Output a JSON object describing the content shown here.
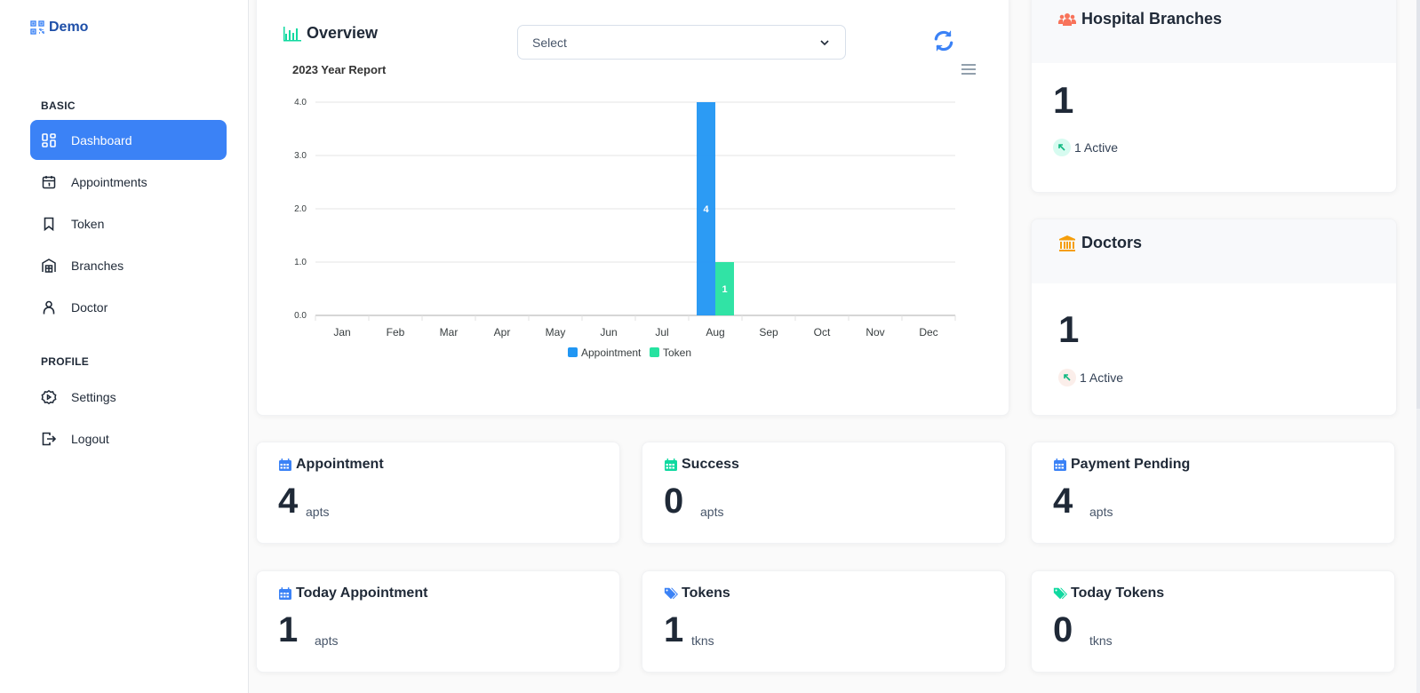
{
  "brand": {
    "name": "Demo",
    "icon": "qr-code-icon",
    "color": "#1e4fa8"
  },
  "sidebar": {
    "sections": [
      {
        "label": "BASIC",
        "items": [
          {
            "label": "Dashboard",
            "icon": "dashboard-icon",
            "active": true
          },
          {
            "label": "Appointments",
            "icon": "calendar-icon",
            "active": false
          },
          {
            "label": "Token",
            "icon": "bookmark-icon",
            "active": false
          },
          {
            "label": "Branches",
            "icon": "building-icon",
            "active": false
          },
          {
            "label": "Doctor",
            "icon": "user-icon",
            "active": false
          }
        ]
      },
      {
        "label": "PROFILE",
        "items": [
          {
            "label": "Settings",
            "icon": "gear-icon",
            "active": false
          },
          {
            "label": "Logout",
            "icon": "logout-icon",
            "active": false
          }
        ]
      }
    ],
    "active_color": "#3b82f6"
  },
  "overview": {
    "title": "Overview",
    "select": {
      "value": "Select"
    },
    "refresh_icon": "refresh-icon",
    "menu_icon": "hamburger-menu-icon"
  },
  "chart_data": {
    "type": "bar",
    "title": "2023 Year Report",
    "categories": [
      "Jan",
      "Feb",
      "Mar",
      "Apr",
      "May",
      "Jun",
      "Jul",
      "Aug",
      "Sep",
      "Oct",
      "Nov",
      "Dec"
    ],
    "series": [
      {
        "name": "Appointment",
        "color": "#2196f3",
        "values": [
          0,
          0,
          0,
          0,
          0,
          0,
          0,
          4,
          0,
          0,
          0,
          0
        ]
      },
      {
        "name": "Token",
        "color": "#26e2a0",
        "values": [
          0,
          0,
          0,
          0,
          0,
          0,
          0,
          1,
          0,
          0,
          0,
          0
        ]
      }
    ],
    "ylim": [
      0,
      4
    ],
    "yticks": [
      "0.0",
      "1.0",
      "2.0",
      "3.0",
      "4.0"
    ],
    "grid": true,
    "legend": "bottom-center",
    "data_labels": true,
    "xlabel": "",
    "ylabel": ""
  },
  "branches": {
    "title": "Hospital Branches",
    "icon": "users-icon",
    "icon_color": "#f8735a",
    "count": "1",
    "active_text": "1 Active"
  },
  "doctors": {
    "title": "Doctors",
    "icon": "bank-icon",
    "icon_color": "#f59e0b",
    "count": "1",
    "active_text": "1 Active"
  },
  "stats": [
    {
      "title": "Appointment",
      "icon": "calendar-icon",
      "icon_color": "#3b82f6",
      "value": "4",
      "unit": "apts"
    },
    {
      "title": "Success",
      "icon": "calendar-icon",
      "icon_color": "#10d9a0",
      "value": "0",
      "unit": "apts"
    },
    {
      "title": "Payment Pending",
      "icon": "calendar-icon",
      "icon_color": "#3b82f6",
      "value": "4",
      "unit": "apts"
    },
    {
      "title": "Today Appointment",
      "icon": "calendar-icon",
      "icon_color": "#3b82f6",
      "value": "1",
      "unit": "apts"
    },
    {
      "title": "Tokens",
      "icon": "tags-icon",
      "icon_color": "#3b82f6",
      "value": "1",
      "unit": "tkns"
    },
    {
      "title": "Today Tokens",
      "icon": "tags-icon",
      "icon_color": "#10d9a0",
      "value": "0",
      "unit": "tkns"
    }
  ]
}
